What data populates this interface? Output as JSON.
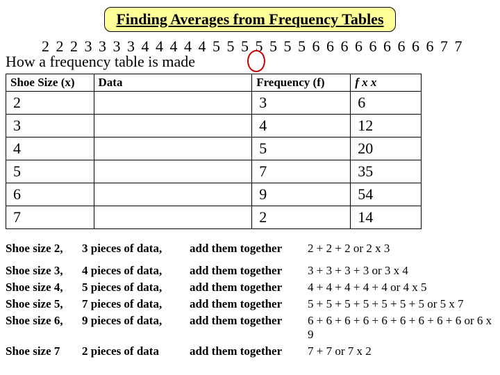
{
  "title": "Finding Averages from Frequency Tables",
  "data_run": "2  2  2  3 3 3 3 4 4 4 4 4 5 5 5 5 5 5 5 6 6 6 6 6 6 6 6 6 7 7",
  "how_line": "How a frequency table is made",
  "table": {
    "headers": {
      "shoe": "Shoe Size (x)",
      "data": "Data",
      "freq": "Frequency (f)",
      "fxx": "f x x"
    },
    "rows": [
      {
        "x": "2",
        "f": "3",
        "fxx": "6"
      },
      {
        "x": "3",
        "f": "4",
        "fxx": "12"
      },
      {
        "x": "4",
        "f": "5",
        "fxx": "20"
      },
      {
        "x": "5",
        "f": "7",
        "fxx": "35"
      },
      {
        "x": "6",
        "f": "9",
        "fxx": "54"
      },
      {
        "x": "7",
        "f": "2",
        "fxx": "14"
      }
    ]
  },
  "explain": [
    {
      "label": "Shoe size 2,",
      "pieces": "3 pieces of data,",
      "action": "add them together",
      "calc": "2 + 2 + 2          or 2 x 3"
    },
    {
      "label": "Shoe size 3,",
      "pieces": "4 pieces of data,",
      "action": "add them together",
      "calc": " 3 + 3 + 3 + 3   or 3 x 4"
    },
    {
      "label": "Shoe size 4,",
      "pieces": "5 pieces of data,",
      "action": "add them together",
      "calc": "  4 + 4 + 4 + 4 + 4    or 4 x 5"
    },
    {
      "label": "Shoe size 5,",
      "pieces": "7 pieces of data,",
      "action": "add them together",
      "calc": "   5 + 5 + 5 + 5 + 5 + 5 + 5 or 5 x 7"
    },
    {
      "label": "Shoe size 6,",
      "pieces": "9 pieces of data,",
      "action": "add them together",
      "calc": " 6 + 6 + 6 + 6 + 6 + 6 + 6 + 6 + 6 or 6 x 9"
    },
    {
      "label": "Shoe size 7",
      "pieces": "2 pieces of data",
      "action": "add them together",
      "calc": "7 + 7        or 7 x 2"
    }
  ]
}
